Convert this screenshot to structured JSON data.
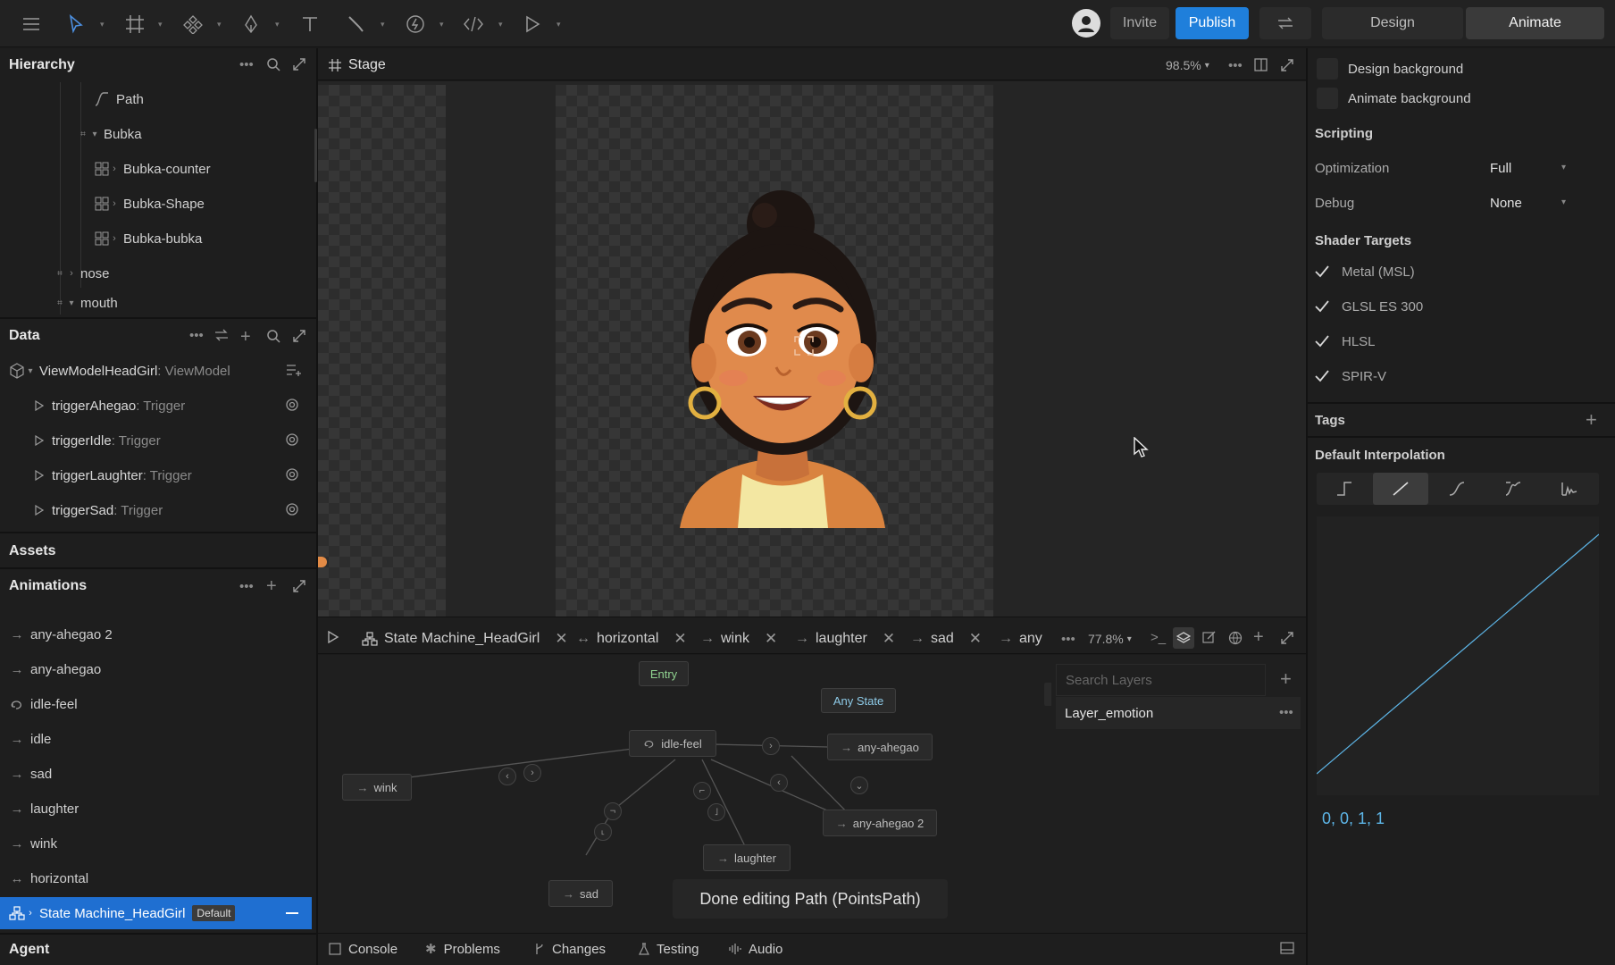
{
  "topbar": {
    "invite_label": "Invite",
    "publish_label": "Publish",
    "mode_design": "Design",
    "mode_animate": "Animate"
  },
  "hierarchy": {
    "title": "Hierarchy",
    "items": [
      {
        "label": "Path",
        "icon": "path-icon"
      },
      {
        "label": "Bubka",
        "icon": "group-icon"
      },
      {
        "label": "Bubka-counter",
        "icon": "component-icon"
      },
      {
        "label": "Bubka-Shape",
        "icon": "component-icon"
      },
      {
        "label": "Bubka-bubka",
        "icon": "component-icon"
      },
      {
        "label": "nose",
        "icon": "group-icon"
      },
      {
        "label": "mouth",
        "icon": "group-icon"
      }
    ]
  },
  "data_panel": {
    "title": "Data",
    "viewmodel_name": "ViewModelHeadGirl",
    "viewmodel_type": ": ViewModel",
    "properties": [
      {
        "name": "triggerAhegao",
        "type": ": Trigger"
      },
      {
        "name": "triggerIdle",
        "type": ": Trigger"
      },
      {
        "name": "triggerLaughter",
        "type": ": Trigger"
      },
      {
        "name": "triggerSad",
        "type": ": Trigger"
      }
    ]
  },
  "assets": {
    "title": "Assets"
  },
  "animations": {
    "title": "Animations",
    "items": [
      {
        "label": "any-ahegao 2",
        "icon": "arrow-right-icon"
      },
      {
        "label": "any-ahegao",
        "icon": "arrow-right-icon"
      },
      {
        "label": "idle-feel",
        "icon": "loop-icon"
      },
      {
        "label": "idle",
        "icon": "arrow-right-icon"
      },
      {
        "label": "sad",
        "icon": "arrow-right-icon"
      },
      {
        "label": "laughter",
        "icon": "arrow-right-icon"
      },
      {
        "label": "wink",
        "icon": "arrow-right-icon"
      },
      {
        "label": "horizontal",
        "icon": "pingpong-icon"
      }
    ],
    "selected_label": "State Machine_HeadGirl",
    "selected_badge": "Default"
  },
  "agent": {
    "title": "Agent"
  },
  "stage": {
    "title": "Stage",
    "zoom": "98.5%"
  },
  "timeline": {
    "tabs": [
      {
        "label": "State Machine_HeadGirl"
      },
      {
        "label": "horizontal"
      },
      {
        "label": "wink"
      },
      {
        "label": "laughter"
      },
      {
        "label": "sad"
      },
      {
        "label": "any"
      }
    ],
    "zoom": "77.8%",
    "search_placeholder": "Search Layers",
    "layer_name": "Layer_emotion",
    "nodes": {
      "entry": "Entry",
      "any_state": "Any State",
      "idle_feel": "idle-feel",
      "any_ahegao": "any-ahegao",
      "any_ahegao_2": "any-ahegao 2",
      "wink": "wink",
      "laughter": "laughter",
      "sad": "sad"
    },
    "toast": "Done editing Path (PointsPath)"
  },
  "bottombar": {
    "console": "Console",
    "problems": "Problems",
    "changes": "Changes",
    "testing": "Testing",
    "audio": "Audio"
  },
  "inspector": {
    "design_background": "Design background",
    "animate_background": "Animate background",
    "scripting_title": "Scripting",
    "optimization_label": "Optimization",
    "optimization_value": "Full",
    "debug_label": "Debug",
    "debug_value": "None",
    "shader_title": "Shader Targets",
    "shader_targets": [
      {
        "label": "Metal (MSL)",
        "checked": true
      },
      {
        "label": "GLSL ES 300",
        "checked": true
      },
      {
        "label": "HLSL",
        "checked": true
      },
      {
        "label": "SPIR-V",
        "checked": true
      }
    ],
    "tags_title": "Tags",
    "interp_title": "Default Interpolation",
    "curve_values": "0, 0, 1, 1"
  },
  "colors": {
    "accent": "#1f7fdb",
    "curve": "#5db6e8",
    "selection": "#1f6fd1"
  }
}
